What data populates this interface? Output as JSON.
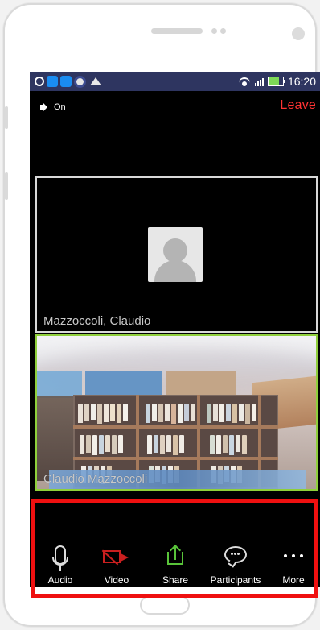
{
  "status_bar": {
    "time": "16:20"
  },
  "top_controls": {
    "audio_state": "On",
    "leave_label": "Leave"
  },
  "participants": [
    {
      "name": "Mazzoccoli, Claudio"
    },
    {
      "name": "Claudio Mazzoccoli"
    }
  ],
  "toolbar": {
    "items": [
      {
        "label": "Audio"
      },
      {
        "label": "Video"
      },
      {
        "label": "Share"
      },
      {
        "label": "Participants"
      },
      {
        "label": "More"
      }
    ]
  },
  "colors": {
    "leave": "#ff3333",
    "video_off": "#c91f1f",
    "share": "#59c43a",
    "active_tile_border": "#8fcf3b",
    "highlight": "#ef1010"
  },
  "icons": {
    "status_left": [
      "chat-icon",
      "app-icon",
      "app-icon",
      "chrome-icon",
      "notification-icon"
    ],
    "status_right": [
      "wifi-icon",
      "signal-icon",
      "battery-icon"
    ],
    "toolbar": [
      "microphone-icon",
      "video-camera-off-icon",
      "share-icon",
      "participants-icon",
      "more-icon"
    ]
  }
}
